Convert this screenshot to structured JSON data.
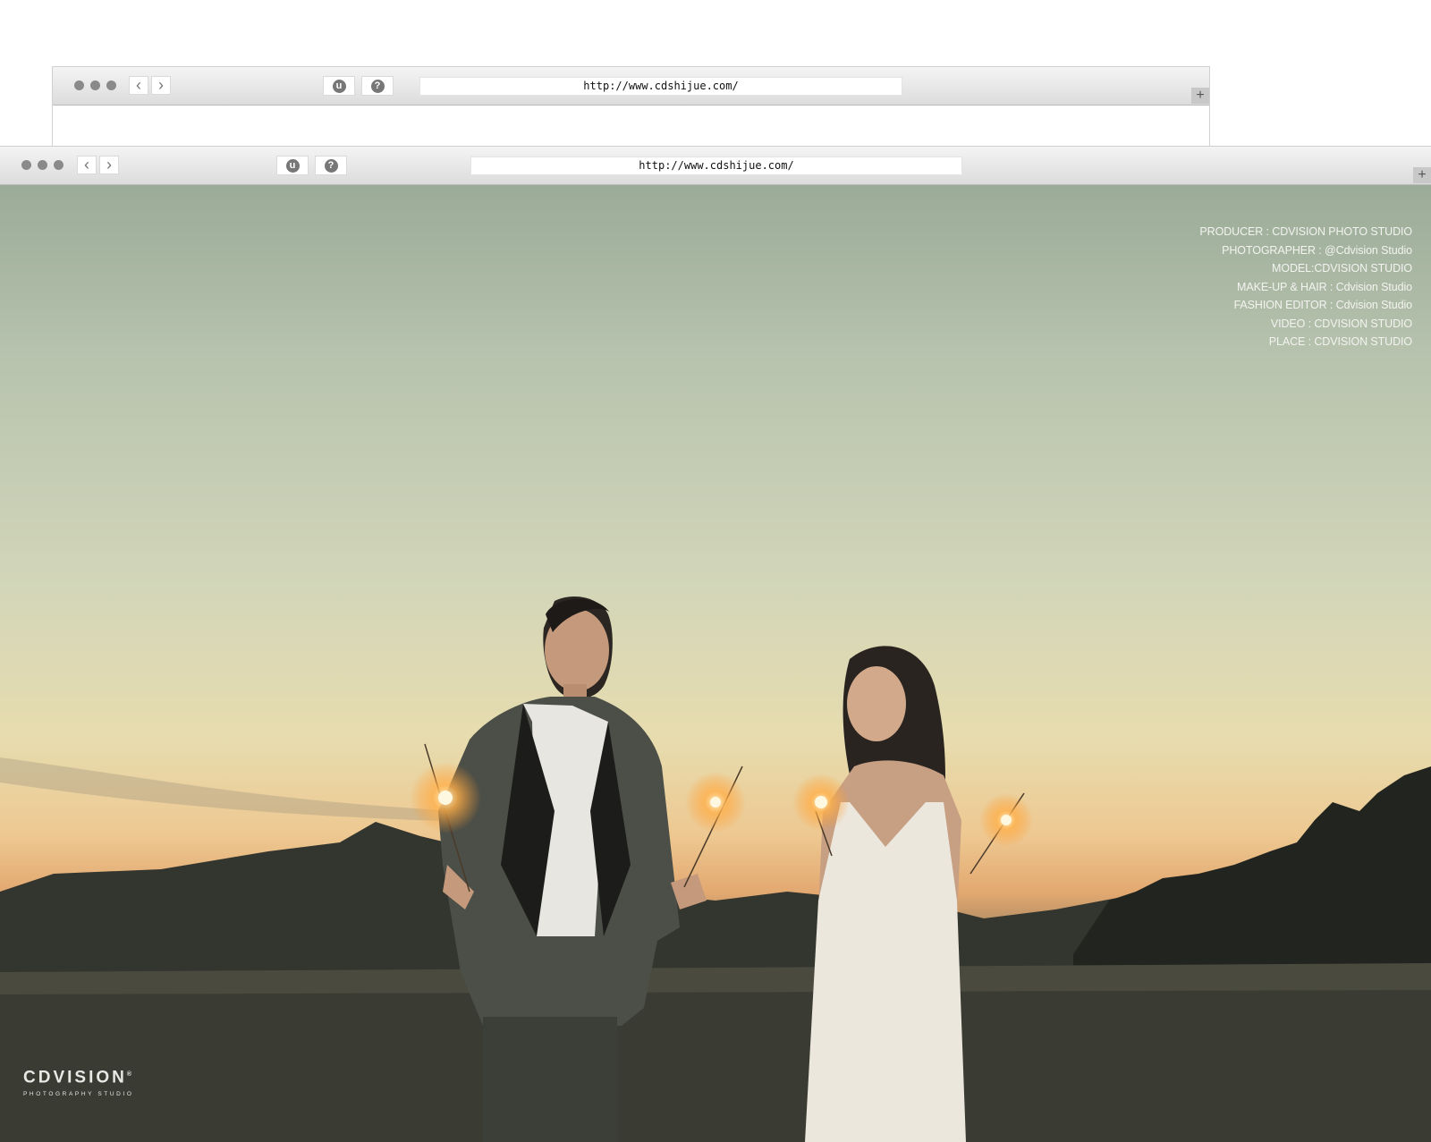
{
  "browser": {
    "url": "http://www.cdshijue.com/",
    "back_icon": "‹",
    "forward_icon": "›",
    "button_u": "u",
    "button_help": "?",
    "new_tab": "+"
  },
  "credits": [
    "PRODUCER :  CDVISION PHOTO STUDIO",
    "PHOTOGRAPHER :  @Cdvision Studio",
    "MODEL:CDVISION STUDIO",
    "MAKE-UP &  HAIR :  Cdvision Studio",
    "FASHION EDITOR  :    Cdvision Studio",
    "VIDEO  :   CDVISION STUDIO",
    "PLACE :    CDVISION STUDIO"
  ],
  "logo": {
    "brand": "CDVISION",
    "registered": "®",
    "tagline": "PHOTOGRAPHY STUDIO"
  },
  "colors": {
    "toolbar": "#e6e6e6",
    "sky_top": "#9aab97",
    "sunset": "#eec891",
    "ground": "#3a3b33"
  }
}
